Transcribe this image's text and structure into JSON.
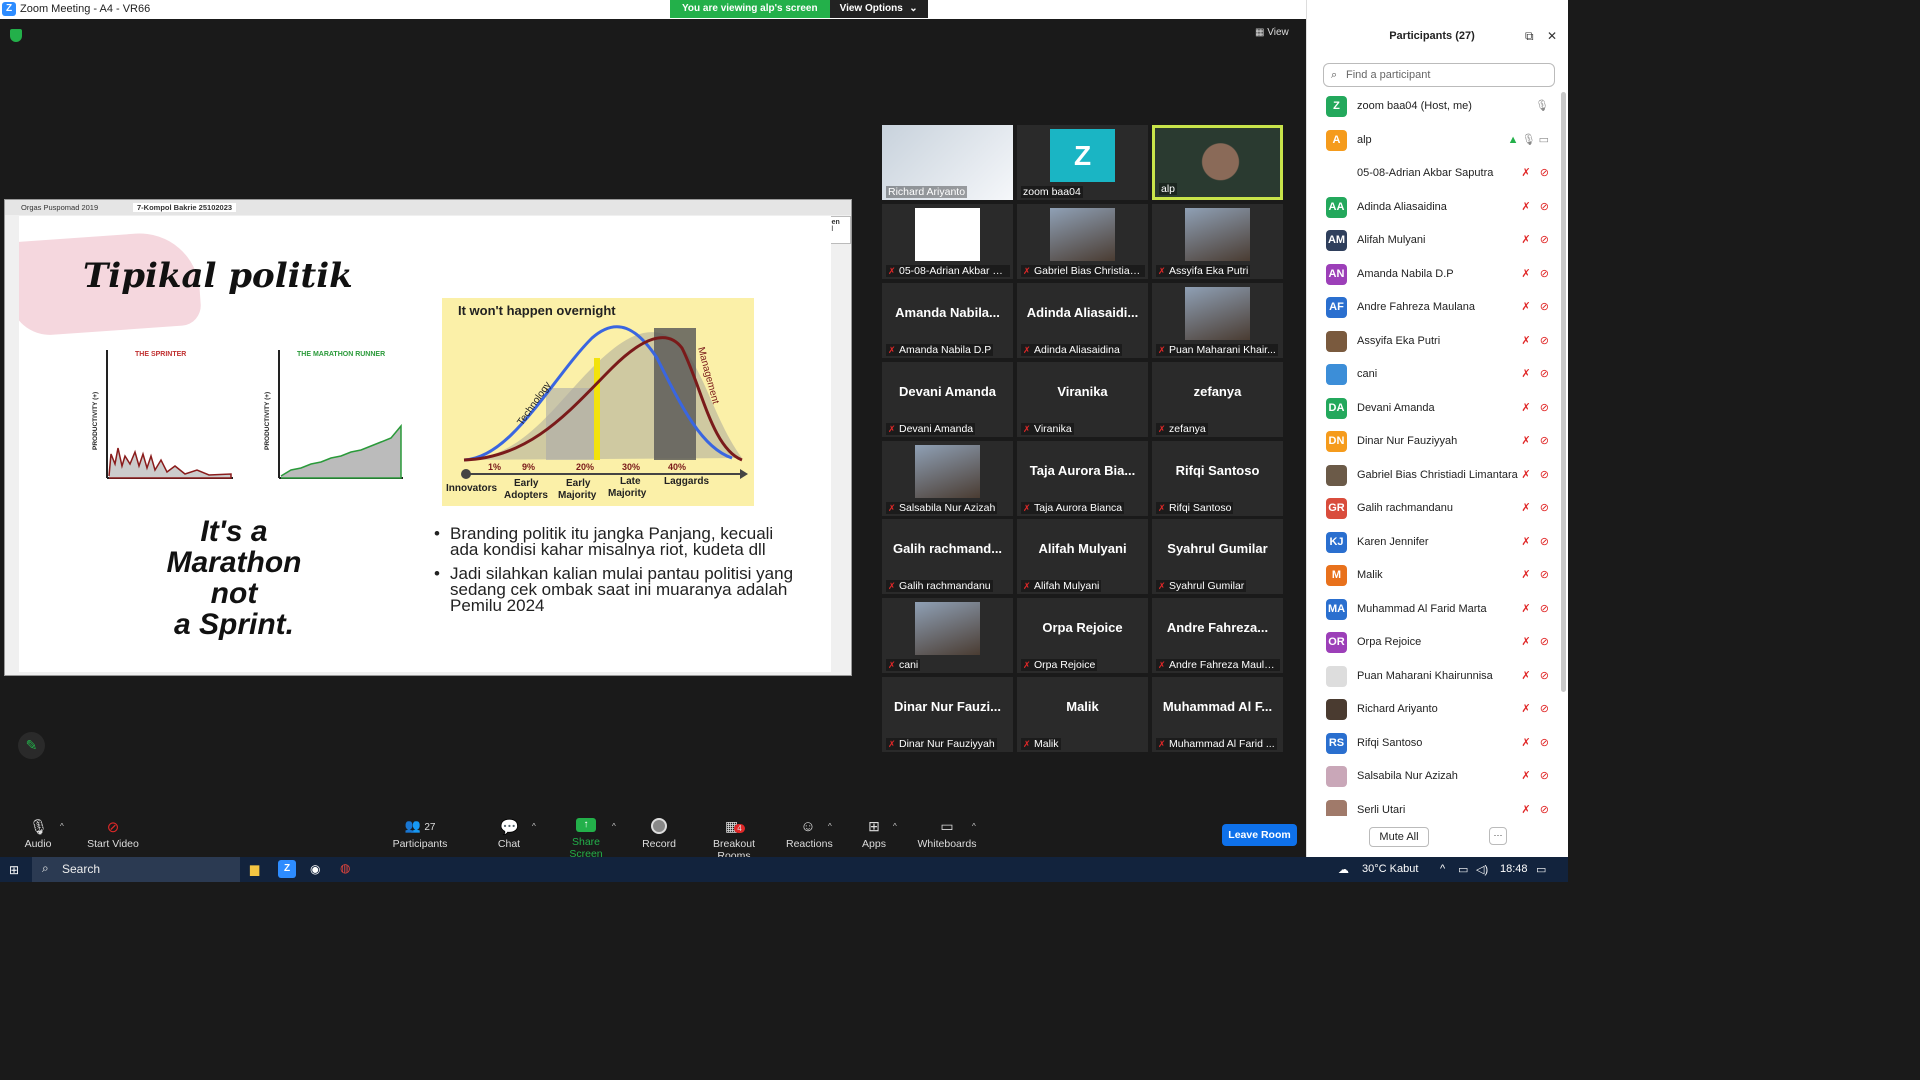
{
  "window": {
    "title": "Zoom Meeting - A4 - VR66",
    "viewing_label": "You are viewing alp's screen",
    "view_options": "View Options",
    "view_button": "View"
  },
  "share": {
    "tabs": [
      "Orgas Puspomad 2019",
      "7-Kompol Bakrie 25102023"
    ],
    "fullscreen_menu": [
      "Full Screen",
      "Close Full Scre"
    ],
    "slide": {
      "title": "Tipikal politik",
      "sprinter_label": "THE SPRINTER",
      "marathon_label": "THE MARATHON RUNNER",
      "productivity_label": "PRODUCTIVITY (+)",
      "marathon_text": [
        "It's a",
        "Marathon",
        "not",
        "a Sprint."
      ],
      "adoption": {
        "heading": "It won't happen overnight",
        "technology": "Technology",
        "management": "Management",
        "percents": [
          "1%",
          "9%",
          "20%",
          "30%",
          "40%"
        ],
        "segments": [
          "Innovators",
          "Early Adopters",
          "Early Majority",
          "Late Majority",
          "Laggards"
        ]
      },
      "bullets": [
        "Branding politik itu jangka Panjang, kecuali ada kondisi kahar misalnya riot, kudeta dll",
        "Jadi silahkan kalian mulai pantau politisi yang sedang cek ombak saat ini muaranya adalah Pemilu 2024"
      ]
    }
  },
  "tiles": [
    {
      "name": "Richard Ariyanto",
      "big": "",
      "type": "screen"
    },
    {
      "name": "zoom baa04",
      "big": "",
      "type": "avatar",
      "letter": "Z"
    },
    {
      "name": "alp",
      "big": "",
      "type": "video"
    },
    {
      "name": "05-08-Adrian Akbar S...",
      "big": "",
      "type": "blank"
    },
    {
      "name": "Gabriel Bias Christiad...",
      "big": "",
      "type": "photo"
    },
    {
      "name": "Assyifa Eka Putri",
      "big": "",
      "type": "photo"
    },
    {
      "name": "Amanda Nabila D.P",
      "big": "Amanda  Nabila...",
      "type": "text"
    },
    {
      "name": "Adinda Aliasaidina",
      "big": "Adinda  Aliasaidi...",
      "type": "text"
    },
    {
      "name": "Puan Maharani Khair...",
      "big": "",
      "type": "photo"
    },
    {
      "name": "Devani Amanda",
      "big": "Devani Amanda",
      "type": "text"
    },
    {
      "name": "Viranika",
      "big": "Viranika",
      "type": "text"
    },
    {
      "name": "zefanya",
      "big": "zefanya",
      "type": "text"
    },
    {
      "name": "Salsabila Nur Azizah",
      "big": "",
      "type": "photo"
    },
    {
      "name": "Taja Aurora Bianca",
      "big": "Taja Aurora Bia...",
      "type": "text"
    },
    {
      "name": "Rifqi Santoso",
      "big": "Rifqi Santoso",
      "type": "text"
    },
    {
      "name": "Galih rachmandanu",
      "big": "Galih  rachmand...",
      "type": "text"
    },
    {
      "name": "Alifah Mulyani",
      "big": "Alifah Mulyani",
      "type": "text"
    },
    {
      "name": "Syahrul Gumilar",
      "big": "Syahrul Gumilar",
      "type": "text"
    },
    {
      "name": "cani",
      "big": "",
      "type": "photo"
    },
    {
      "name": "Orpa Rejoice",
      "big": "Orpa Rejoice",
      "type": "text"
    },
    {
      "name": "Andre Fahreza Maula...",
      "big": "Andre  Fahreza...",
      "type": "text"
    },
    {
      "name": "Dinar Nur Fauziyyah",
      "big": "Dinar  Nur  Fauzi...",
      "type": "text"
    },
    {
      "name": "Malik",
      "big": "Malik",
      "type": "text"
    },
    {
      "name": "Muhammad Al Farid ...",
      "big": "Muhammad  Al  F...",
      "type": "text"
    }
  ],
  "toolbar": {
    "audio": "Audio",
    "start_video": "Start Video",
    "participants": "Participants",
    "participants_count": "27",
    "chat": "Chat",
    "share_screen": "Share Screen",
    "record": "Record",
    "breakout": "Breakout Rooms",
    "breakout_badge": "4",
    "reactions": "Reactions",
    "apps": "Apps",
    "whiteboards": "Whiteboards",
    "leave": "Leave Room"
  },
  "panel": {
    "title": "Participants (27)",
    "search_placeholder": "Find a participant",
    "mute_all": "Mute All",
    "more": "···",
    "participants": [
      {
        "initials": "Z",
        "color": "#23a85c",
        "name": "zoom baa04 (Host, me)"
      },
      {
        "initials": "A",
        "color": "#f59b1c",
        "name": "alp"
      },
      {
        "initials": "",
        "color": "#ffffff",
        "name": "05-08-Adrian Akbar Saputra"
      },
      {
        "initials": "AA",
        "color": "#23a85c",
        "name": "Adinda Aliasaidina"
      },
      {
        "initials": "AM",
        "color": "#2f3f5c",
        "name": "Alifah Mulyani"
      },
      {
        "initials": "AN",
        "color": "#9c3fb8",
        "name": "Amanda Nabila D.P"
      },
      {
        "initials": "AF",
        "color": "#2a6fcf",
        "name": "Andre Fahreza Maulana"
      },
      {
        "initials": "",
        "color": "#7a5a3e",
        "name": "Assyifa Eka Putri"
      },
      {
        "initials": "",
        "color": "#3c8ed8",
        "name": "cani"
      },
      {
        "initials": "DA",
        "color": "#23a85c",
        "name": "Devani Amanda"
      },
      {
        "initials": "DN",
        "color": "#f59b1c",
        "name": "Dinar Nur Fauziyyah"
      },
      {
        "initials": "",
        "color": "#6b5a48",
        "name": "Gabriel Bias Christiadi Limantara"
      },
      {
        "initials": "GR",
        "color": "#d94c3c",
        "name": "Galih rachmandanu"
      },
      {
        "initials": "KJ",
        "color": "#2a6fcf",
        "name": "Karen Jennifer"
      },
      {
        "initials": "M",
        "color": "#e8711c",
        "name": "Malik"
      },
      {
        "initials": "MA",
        "color": "#2a6fcf",
        "name": "Muhammad Al Farid Marta"
      },
      {
        "initials": "OR",
        "color": "#9c3fb8",
        "name": "Orpa Rejoice"
      },
      {
        "initials": "",
        "color": "#dddddd",
        "name": "Puan Maharani Khairunnisa"
      },
      {
        "initials": "",
        "color": "#4a3b30",
        "name": "Richard Ariyanto"
      },
      {
        "initials": "RS",
        "color": "#2a6fcf",
        "name": "Rifqi Santoso"
      },
      {
        "initials": "",
        "color": "#c9a7b8",
        "name": "Salsabila Nur Azizah"
      },
      {
        "initials": "",
        "color": "#a07a6a",
        "name": "Serli Utari"
      }
    ]
  },
  "taskbar": {
    "search": "Search",
    "weather": "30°C  Kabut",
    "time": "18:48"
  }
}
